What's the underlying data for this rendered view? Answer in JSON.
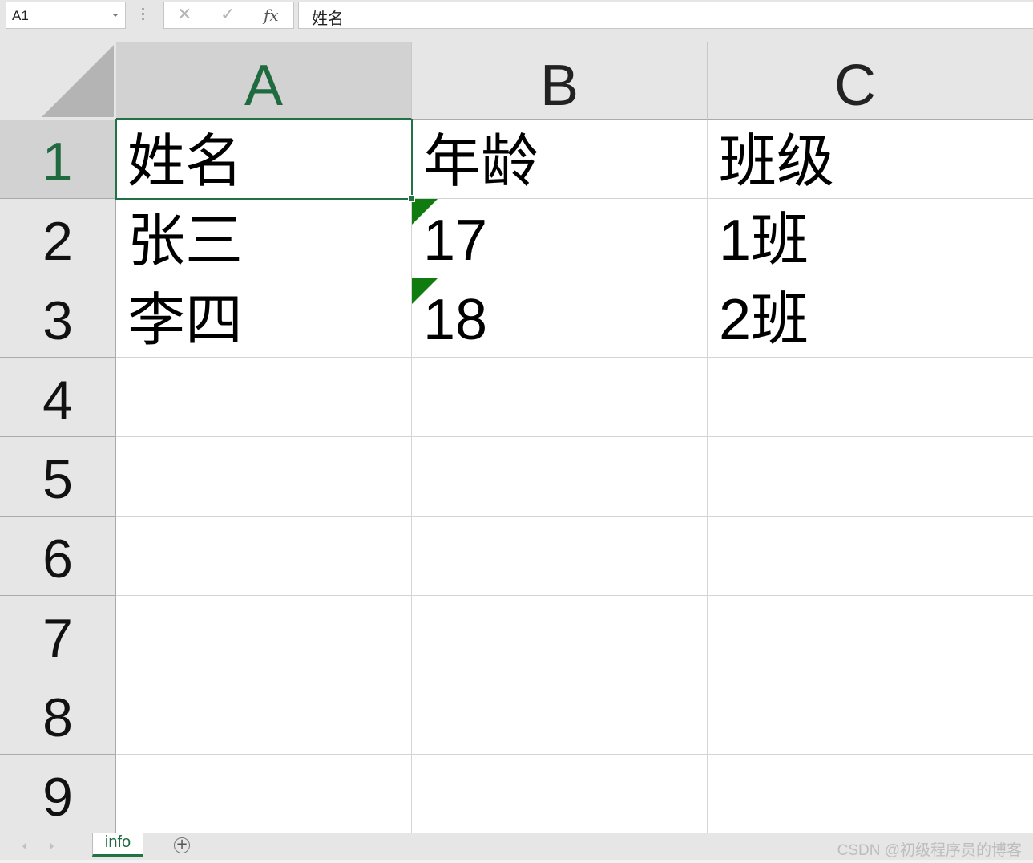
{
  "formula_bar": {
    "name_box": "A1",
    "cancel_icon": "✕",
    "enter_icon": "✓",
    "fx_label": "fx",
    "formula_value": "姓名"
  },
  "columns": [
    {
      "label": "A",
      "selected": true
    },
    {
      "label": "B",
      "selected": false
    },
    {
      "label": "C",
      "selected": false
    }
  ],
  "rows": [
    {
      "label": "1",
      "selected": true
    },
    {
      "label": "2",
      "selected": false
    },
    {
      "label": "3",
      "selected": false
    },
    {
      "label": "4",
      "selected": false
    },
    {
      "label": "5",
      "selected": false
    },
    {
      "label": "6",
      "selected": false
    },
    {
      "label": "7",
      "selected": false
    },
    {
      "label": "8",
      "selected": false
    },
    {
      "label": "9",
      "selected": false
    }
  ],
  "cells": [
    [
      "姓名",
      "年龄",
      "班级"
    ],
    [
      "张三",
      "17",
      "1班"
    ],
    [
      "李四",
      "18",
      "2班"
    ]
  ],
  "number_stored_as_text_flags": [
    "B2",
    "B3"
  ],
  "selected_cell": "A1",
  "sheet_tabs": [
    {
      "label": "info",
      "active": true
    }
  ],
  "add_sheet_icon": "+",
  "watermark": "CSDN @初级程序员的博客",
  "colors": {
    "accent_green": "#217346",
    "error_flag_green": "#107c10",
    "header_bg": "#e6e6e6",
    "header_selected_bg": "#d2d2d2"
  }
}
